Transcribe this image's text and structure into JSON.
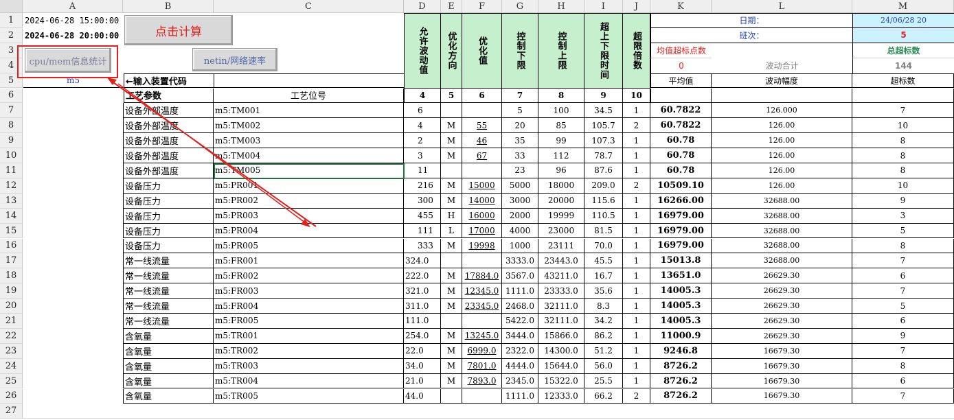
{
  "column_headers": [
    "A",
    "B",
    "C",
    "D",
    "E",
    "F",
    "G",
    "H",
    "I",
    "J",
    "K",
    "L",
    "M"
  ],
  "row_numbers": [
    "1",
    "2",
    "3",
    "4",
    "5",
    "6",
    "7",
    "8",
    "9",
    "10",
    "11",
    "12",
    "13",
    "14",
    "15",
    "16",
    "17",
    "18",
    "19",
    "20",
    "21",
    "22",
    "23",
    "24",
    "25",
    "26",
    "27"
  ],
  "top": {
    "a1": "2024-06-28 15:00:00",
    "a2": "2024-06-28 20:00:00",
    "calc_button": "点击计算",
    "cpu_button": "cpu/mem信息统计",
    "netin_button": "netin/网络速率",
    "a5": "m5",
    "b5": "←输入装置代码",
    "b6": "工艺参数",
    "c6": "工艺位号",
    "k1": "日期：",
    "k2": "班次：",
    "m1": "24/06/28 20",
    "m2": "5",
    "k3": "均值超标点数",
    "k4": "0",
    "l4": "波动合计",
    "m3": "总超标数",
    "m4": "144",
    "k5": "平均值",
    "l5": "波动幅度",
    "m5": "超标数"
  },
  "vertical_headers": {
    "d": "允许波动值",
    "e": "优化方向",
    "f": "优化值",
    "g": "控制下限",
    "h": "控制上限",
    "i": "超上下限时间",
    "j": "超限倍数"
  },
  "col_numbers": [
    "4",
    "5",
    "6",
    "7",
    "8",
    "9",
    "10"
  ],
  "rows": [
    {
      "b": "设备外部温度",
      "c": "m5:TM001",
      "d": "6",
      "e": "",
      "f": "",
      "g": "5",
      "h": "100",
      "i": "34.5",
      "j": "1",
      "k": "60.7822",
      "l": "126.000",
      "m": "7"
    },
    {
      "b": "设备外部温度",
      "c": "m5:TM002",
      "d": "4",
      "e": "M",
      "f": "55",
      "g": "20",
      "h": "85",
      "i": "105.7",
      "j": "2",
      "k": "60.7822",
      "l": "126.00",
      "m": "10"
    },
    {
      "b": "设备外部温度",
      "c": "m5:TM003",
      "d": "2",
      "e": "M",
      "f": "46",
      "g": "35",
      "h": "99",
      "i": "107.3",
      "j": "1",
      "k": "60.78",
      "l": "126.00",
      "m": "8"
    },
    {
      "b": "设备外部温度",
      "c": "m5:TM004",
      "d": "3",
      "e": "M",
      "f": "67",
      "g": "33",
      "h": "112",
      "i": "78.7",
      "j": "1",
      "k": "60.78",
      "l": "126.00",
      "m": "8"
    },
    {
      "b": "设备外部温度",
      "c": "m5:TM005",
      "d": "11",
      "e": "",
      "f": "",
      "g": "23",
      "h": "96",
      "i": "87.6",
      "j": "1",
      "k": "60.78",
      "l": "126.00",
      "m": "8"
    },
    {
      "b": "设备压力",
      "c": "m5:PR001",
      "d": "216",
      "e": "M",
      "f": "15000",
      "g": "5000",
      "h": "18000",
      "i": "209.0",
      "j": "2",
      "k": "10509.10",
      "l": "126.00",
      "m": "10"
    },
    {
      "b": "设备压力",
      "c": "m5:PR002",
      "d": "300",
      "e": "M",
      "f": "14000",
      "g": "3000",
      "h": "20000",
      "i": "115.6",
      "j": "1",
      "k": "16266.00",
      "l": "32688.00",
      "m": "9"
    },
    {
      "b": "设备压力",
      "c": "m5:PR003",
      "d": "455",
      "e": "H",
      "f": "16000",
      "g": "2000",
      "h": "19999",
      "i": "110.5",
      "j": "1",
      "k": "16979.00",
      "l": "32688.00",
      "m": "3"
    },
    {
      "b": "设备压力",
      "c": "m5:PR004",
      "d": "111",
      "e": "L",
      "f": "17000",
      "g": "4000",
      "h": "23000",
      "i": "81.5",
      "j": "1",
      "k": "16979.00",
      "l": "32688.00",
      "m": "5"
    },
    {
      "b": "设备压力",
      "c": "m5:PR005",
      "d": "333",
      "e": "M",
      "f": "19998",
      "g": "1000",
      "h": "23111",
      "i": "70.0",
      "j": "1",
      "k": "16979.00",
      "l": "32688.00",
      "m": "8"
    },
    {
      "b": "常一线流量",
      "c": "m5:FR001",
      "d": "324.0",
      "e": "",
      "f": "",
      "g": "3333.0",
      "h": "23443.0",
      "i": "45.5",
      "j": "1",
      "k": "15013.8",
      "l": "32688.00",
      "m": "7"
    },
    {
      "b": "常一线流量",
      "c": "m5:FR002",
      "d": "222.0",
      "e": "M",
      "f": "17884.0",
      "g": "3567.0",
      "h": "43211.0",
      "i": "16.7",
      "j": "1",
      "k": "13651.0",
      "l": "26629.30",
      "m": "6"
    },
    {
      "b": "常一线流量",
      "c": "m5:FR003",
      "d": "321.0",
      "e": "M",
      "f": "12345.0",
      "g": "1111.0",
      "h": "23333.0",
      "i": "35.6",
      "j": "1",
      "k": "14005.3",
      "l": "26629.30",
      "m": "7"
    },
    {
      "b": "常一线流量",
      "c": "m5:FR004",
      "d": "311.0",
      "e": "M",
      "f": "23345.0",
      "g": "2468.0",
      "h": "32111.0",
      "i": "8.3",
      "j": "1",
      "k": "14005.3",
      "l": "26629.30",
      "m": "5"
    },
    {
      "b": "常一线流量",
      "c": "m5:FR005",
      "d": "111.0",
      "e": "",
      "f": "",
      "g": "5422.0",
      "h": "32111.0",
      "i": "34.2",
      "j": "1",
      "k": "14005.3",
      "l": "26629.30",
      "m": "6"
    },
    {
      "b": "含氧量",
      "c": "m5:TR001",
      "d": "254.0",
      "e": "M",
      "f": "13245.0",
      "g": "3444.0",
      "h": "15866.0",
      "i": "86.2",
      "j": "1",
      "k": "11000.9",
      "l": "26629.30",
      "m": "9"
    },
    {
      "b": "含氧量",
      "c": "m5:TR002",
      "d": "22.0",
      "e": "M",
      "f": "6999.0",
      "g": "2322.0",
      "h": "14300.0",
      "i": "51.2",
      "j": "1",
      "k": "9246.8",
      "l": "16679.30",
      "m": "7"
    },
    {
      "b": "含氧量",
      "c": "m5:TR003",
      "d": "34.0",
      "e": "M",
      "f": "7801.0",
      "g": "4444.0",
      "h": "15644.0",
      "i": "56.0",
      "j": "1",
      "k": "8726.2",
      "l": "16679.30",
      "m": "8"
    },
    {
      "b": "含氧量",
      "c": "m5:TR004",
      "d": "21.0",
      "e": "M",
      "f": "7893.0",
      "g": "2345.0",
      "h": "15322.0",
      "i": "25.5",
      "j": "1",
      "k": "8726.2",
      "l": "16679.30",
      "m": "6"
    },
    {
      "b": "含氧量",
      "c": "m5:TR005",
      "d": "44.0",
      "e": "",
      "f": "",
      "g": "1111.0",
      "h": "12333.0",
      "i": "66.2",
      "j": "2",
      "k": "8726.2",
      "l": "16679.30",
      "m": "7"
    }
  ],
  "colors": {
    "red": "#e3201b",
    "green_fill": "#c6efce",
    "cyan_fill": "#ccf2ff",
    "selection": "#217346",
    "teal_text": "#2e8b57",
    "blue_text": "#1f3fbf"
  }
}
